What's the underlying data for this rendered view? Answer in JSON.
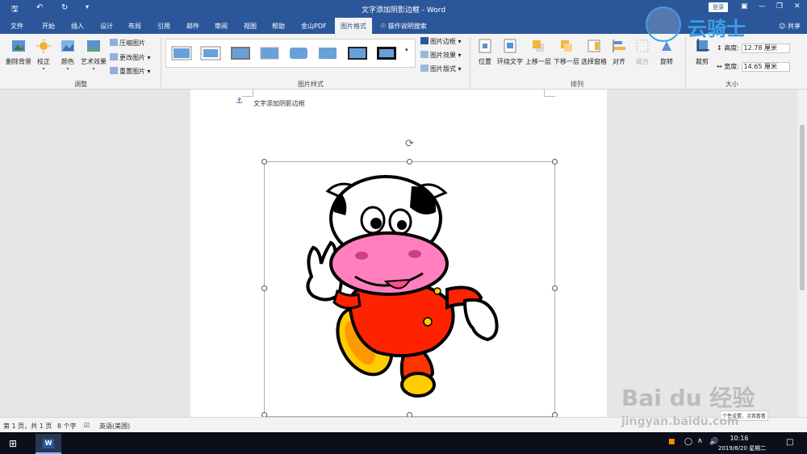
{
  "titlebar": {
    "title": "文字添加阴影边框 - Word",
    "login_label": "登录",
    "qat": [
      "save-icon",
      "undo-icon",
      "redo-icon",
      "customize-icon"
    ]
  },
  "tabs": [
    "文件",
    "开始",
    "插入",
    "设计",
    "布局",
    "引用",
    "邮件",
    "审阅",
    "视图",
    "帮助",
    "金山PDF",
    "图片格式"
  ],
  "tell_me": "操作说明搜索",
  "share_label": "共享",
  "ribbon": {
    "adjust": {
      "remove_bg": "删除背景",
      "corrections": "校正",
      "color": "颜色",
      "artistic": "艺术效果",
      "compress": "压缩图片",
      "change": "更改图片",
      "reset": "重置图片",
      "label": "调整"
    },
    "styles": {
      "border": "图片边框",
      "effects": "图片效果",
      "layout": "图片版式",
      "label": "图片样式"
    },
    "arrange": {
      "position": "位置",
      "wrap": "环绕文字",
      "forward": "上移一层",
      "backward": "下移一层",
      "selection": "选择窗格",
      "align": "对齐",
      "group": "组合",
      "rotate": "旋转",
      "label": "排列"
    },
    "size": {
      "crop": "裁剪",
      "height_label": "高度:",
      "height_value": "12.78 厘米",
      "width_label": "宽度:",
      "width_value": "14.65 厘米",
      "label": "大小"
    }
  },
  "document": {
    "heading": "文字添加阴影边框"
  },
  "statusbar": {
    "page": "第 1 页，共 1 页",
    "words": "8 个字",
    "language": "英语(美国)"
  },
  "taskbar": {
    "time": "10:16",
    "date": "2019/8/20 星期二",
    "tooltip": "个性设置，点我看看"
  },
  "watermarks": {
    "logo_text": "云骑士",
    "baidu": "Bai du 经验",
    "baidu_url": "jingyan.baidu.com"
  },
  "colors": {
    "word_blue": "#2b579a",
    "ribbon_bg": "#f3f3f3",
    "workspace": "#e6e6e6"
  }
}
